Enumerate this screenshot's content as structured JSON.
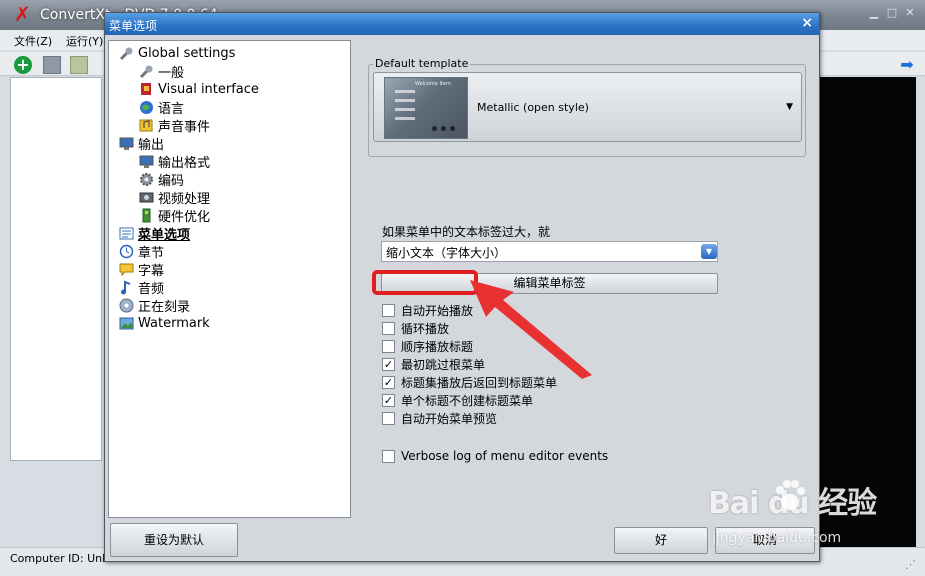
{
  "app": {
    "title": "ConvertXt…DVD 7.0.0.64",
    "menu": [
      "文件(Z)",
      "运行(Y)"
    ],
    "status_text": "Computer ID: Unk"
  },
  "dialog": {
    "title": "菜单选项",
    "close_label": "×",
    "tree": [
      {
        "label": "Global settings",
        "icon": "wrench-icon",
        "level": 0
      },
      {
        "label": "一般",
        "icon": "wrench-icon",
        "level": 1
      },
      {
        "label": "Visual interface",
        "icon": "paint-icon",
        "level": 1
      },
      {
        "label": "语言",
        "icon": "globe-icon",
        "level": 1
      },
      {
        "label": "声音事件",
        "icon": "sound-icon",
        "level": 1
      },
      {
        "label": "输出",
        "icon": "monitor-icon",
        "level": 0
      },
      {
        "label": "输出格式",
        "icon": "monitor-icon",
        "level": 1
      },
      {
        "label": "编码",
        "icon": "gear-icon",
        "level": 1
      },
      {
        "label": "视频处理",
        "icon": "video-icon",
        "level": 1
      },
      {
        "label": "硬件优化",
        "icon": "hardware-icon",
        "level": 1
      },
      {
        "label": "菜单选项",
        "icon": "menu-icon",
        "level": 0,
        "active": true
      },
      {
        "label": "章节",
        "icon": "clock-icon",
        "level": 0
      },
      {
        "label": "字幕",
        "icon": "subtitle-icon",
        "level": 0
      },
      {
        "label": "音频",
        "icon": "music-icon",
        "level": 0
      },
      {
        "label": "正在刻录",
        "icon": "disc-icon",
        "level": 0
      },
      {
        "label": "Watermark",
        "icon": "watermark-icon",
        "level": 0
      }
    ],
    "template": {
      "legend": "Default template",
      "selected": "Metallic (open style)",
      "thumb_title": "Welcome Item"
    },
    "overflow": {
      "label": "如果菜单中的文本标签过大，就",
      "selected": "缩小文本（字体大小）"
    },
    "edit_labels_button": "编辑菜单标签",
    "checkboxes": [
      {
        "label": "自动开始播放",
        "checked": false
      },
      {
        "label": "循环播放",
        "checked": false
      },
      {
        "label": "顺序播放标题",
        "checked": false
      },
      {
        "label": "最初跳过根菜单",
        "checked": true
      },
      {
        "label": "标题集播放后返回到标题菜单",
        "checked": true
      },
      {
        "label": "单个标题不创建标题菜单",
        "checked": true
      },
      {
        "label": "自动开始菜单预览",
        "checked": false
      },
      {
        "label": "Verbose log of menu editor events",
        "checked": false
      }
    ],
    "reset_button": "重设为默认",
    "ok_button": "好",
    "cancel_button": "取消"
  },
  "annotation": {
    "color": "#e02020"
  },
  "watermark": {
    "brand": "Bai du 经验",
    "url": "jingyan.baidu.com"
  }
}
